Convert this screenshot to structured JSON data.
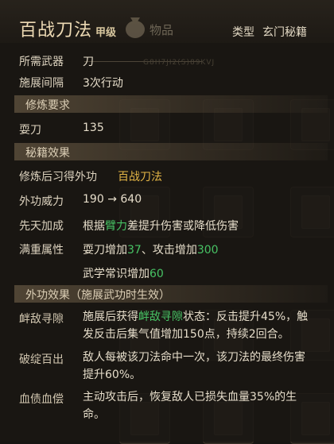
{
  "title": "百战刀法",
  "grade": "甲级",
  "ghost_tab": "物品",
  "ghost_code": "G8H7JI2(S)89KVJ",
  "type": {
    "label": "类型",
    "value": "玄门秘籍"
  },
  "weapon": {
    "label": "所需武器",
    "value": "刀"
  },
  "interval": {
    "label": "施展间隔",
    "value": "3次行动"
  },
  "sec_require": "修炼要求",
  "skill_req": {
    "label": "耍刀",
    "value": "135"
  },
  "sec_effect": "秘籍效果",
  "learned": {
    "label": "修炼后习得外功",
    "value": "百战刀法"
  },
  "power": {
    "label": "外功威力",
    "from": "190",
    "arrow": "→",
    "to": "640"
  },
  "innate": {
    "label": "先天加成",
    "pre": "根据",
    "stat": "臂力",
    "post": "差提升伤害或降低伤害"
  },
  "full": {
    "label": "满重属性",
    "line1": {
      "a": "耍刀增加",
      "a_val": "37",
      "sep": "、攻击增加",
      "b_val": "300"
    },
    "line2": {
      "a": "武学常识增加",
      "a_val": "60"
    }
  },
  "sec_external": "外功效果（施展武功时生效）",
  "effects": [
    {
      "name": "衅敌寻隙",
      "pre": "施展后获得",
      "hl": "衅敌寻隙",
      "l1_rest": "状态：反击提升45%，触",
      "l2": "发反击后集气值增加150点，持续2回合。"
    },
    {
      "name": "破绽百出",
      "l1": "敌人每被该刀法命中一次，该刀法的最终伤害",
      "l2": "提升60%。"
    },
    {
      "name": "血债血偿",
      "l1": "主动攻击后，恢复敌人已损失血量35%的生",
      "l2": "命。"
    }
  ],
  "colors": {
    "gold": "#e3b546",
    "green": "#47c264",
    "text": "#e6ddca"
  }
}
